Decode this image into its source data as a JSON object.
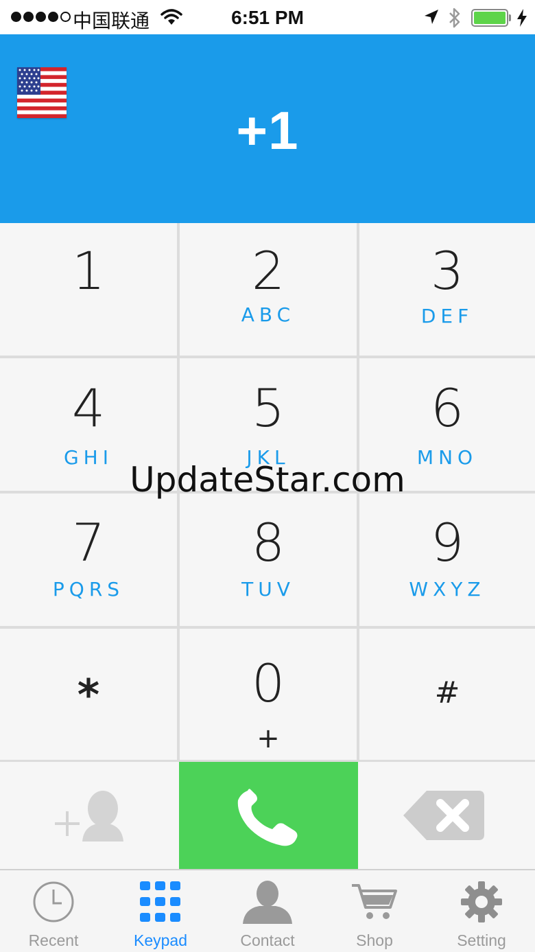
{
  "status_bar": {
    "carrier": "中国联通",
    "time": "6:51 PM",
    "battery_level": 1.0
  },
  "header": {
    "country_flag": "us-flag-icon",
    "dial_value": "+1"
  },
  "keypad": {
    "keys": [
      {
        "digit": "1",
        "letters": ""
      },
      {
        "digit": "2",
        "letters": "ABC"
      },
      {
        "digit": "3",
        "letters": "DEF"
      },
      {
        "digit": "4",
        "letters": "GHI"
      },
      {
        "digit": "5",
        "letters": "JKL"
      },
      {
        "digit": "6",
        "letters": "MNO"
      },
      {
        "digit": "7",
        "letters": "PQRS"
      },
      {
        "digit": "8",
        "letters": "TUV"
      },
      {
        "digit": "9",
        "letters": "WXYZ"
      },
      {
        "digit": "*",
        "letters": ""
      },
      {
        "digit": "0",
        "letters": "+"
      },
      {
        "digit": "#",
        "letters": ""
      }
    ]
  },
  "actions": {
    "add_contact_icon": "add-contact-icon",
    "call_icon": "phone-icon",
    "delete_icon": "backspace-icon"
  },
  "tabs": [
    {
      "label": "Recent",
      "icon": "clock-icon",
      "active": false
    },
    {
      "label": "Keypad",
      "icon": "keypad-grid-icon",
      "active": true
    },
    {
      "label": "Contact",
      "icon": "person-icon",
      "active": false
    },
    {
      "label": "Shop",
      "icon": "cart-icon",
      "active": false
    },
    {
      "label": "Setting",
      "icon": "gear-icon",
      "active": false
    }
  ],
  "watermark": "UpdateStar.com",
  "colors": {
    "accent": "#1a9bea",
    "call_green": "#4cd258",
    "tab_active": "#1a8cff",
    "tab_inactive": "#9a9a9a"
  }
}
